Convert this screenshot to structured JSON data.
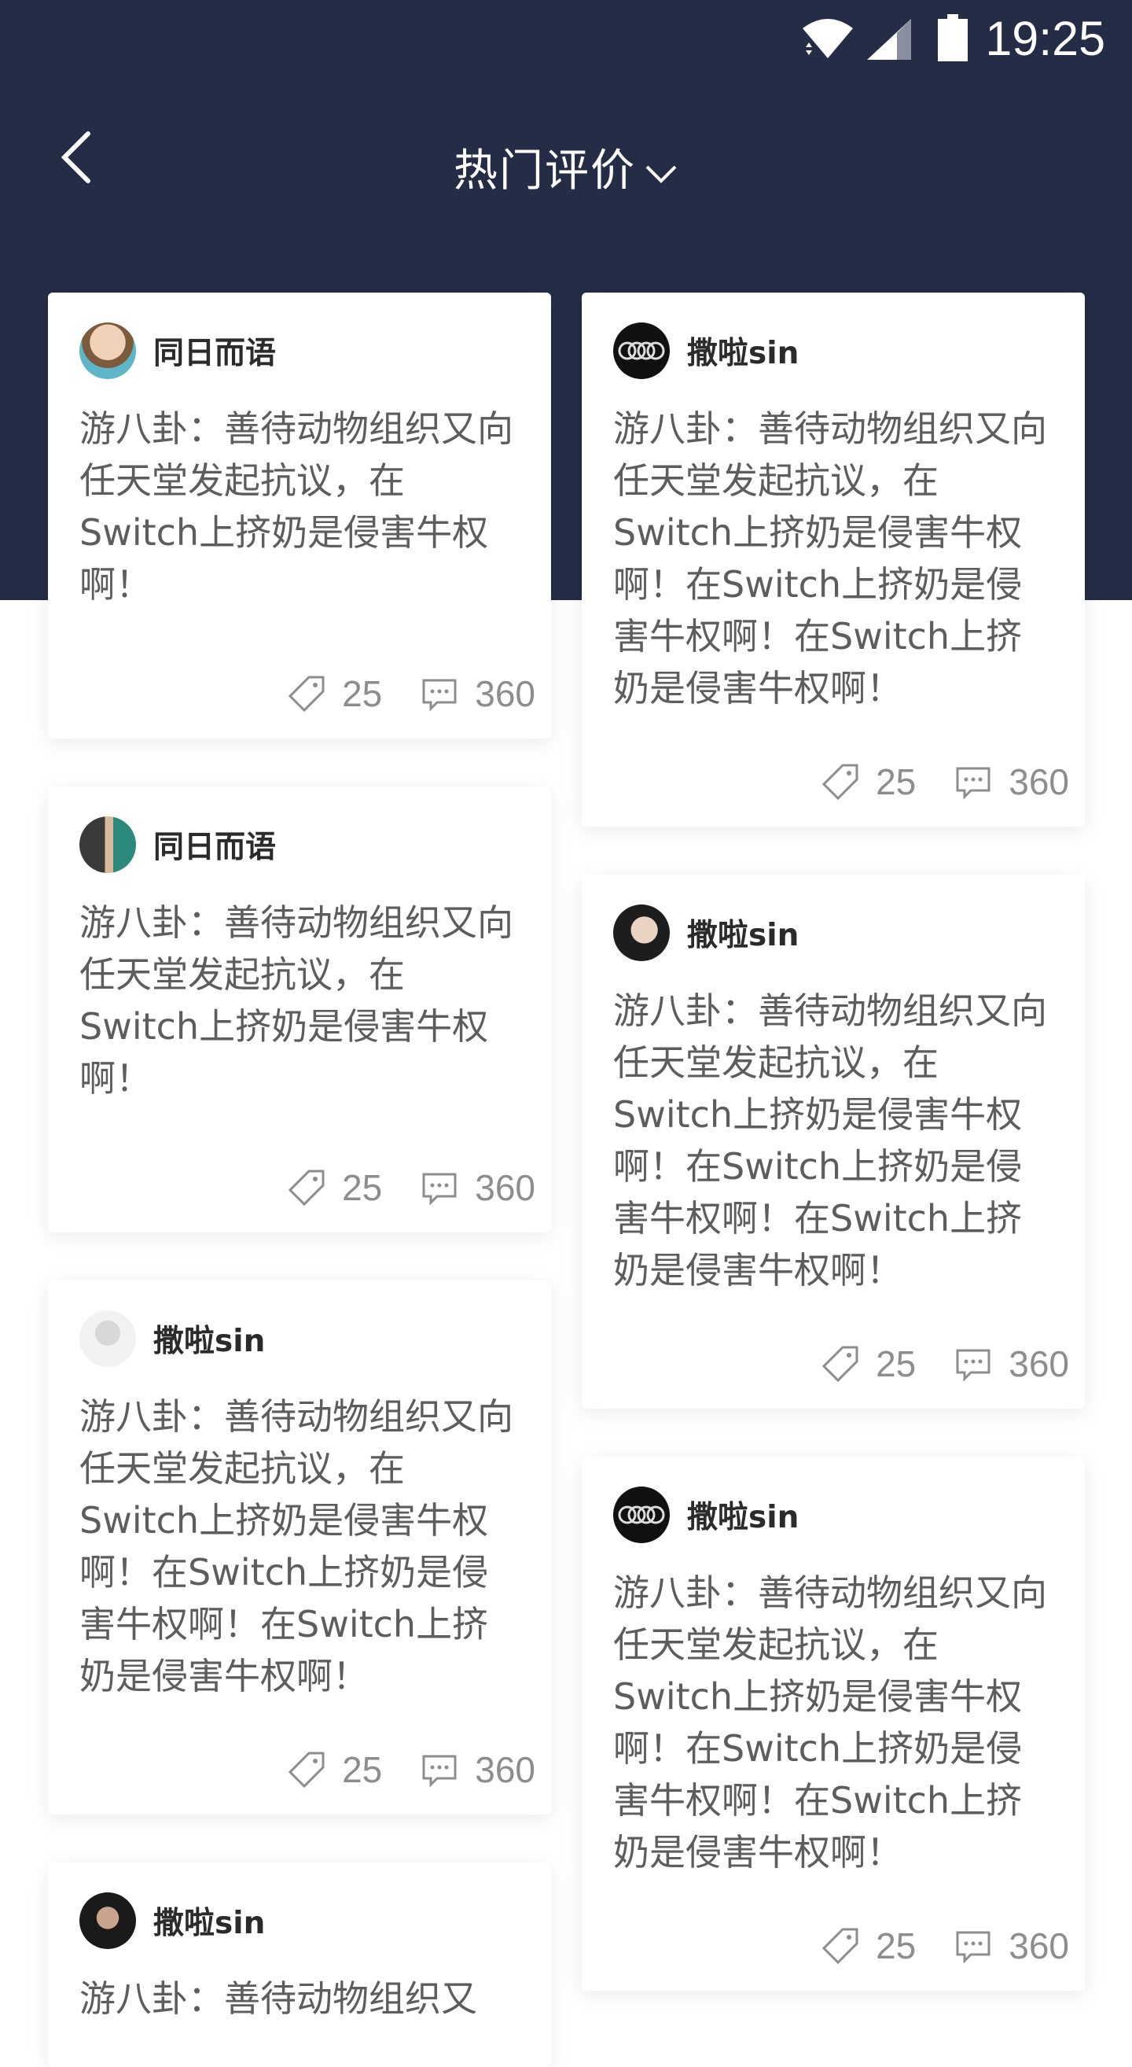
{
  "status_bar": {
    "time": "19:25"
  },
  "nav": {
    "title": "热门评价"
  },
  "cards": [
    {
      "author": "同日而语",
      "avatar": "woman-photo",
      "text": "游八卦：善待动物组织又向任天堂发起抗议，在Switch上挤奶是侵害牛权啊！",
      "likes": "25",
      "comments": "360"
    },
    {
      "author": "撒啦sin",
      "avatar": "rings-logo",
      "text": "游八卦：善待动物组织又向任天堂发起抗议，在Switch上挤奶是侵害牛权啊！在Switch上挤奶是侵害牛权啊！在Switch上挤奶是侵害牛权啊！",
      "likes": "25",
      "comments": "360"
    },
    {
      "author": "同日而语",
      "avatar": "couple-photo",
      "text": "游八卦：善待动物组织又向任天堂发起抗议，在Switch上挤奶是侵害牛权啊！",
      "likes": "25",
      "comments": "360"
    },
    {
      "author": "撒啦sin",
      "avatar": "woman-dark-hair",
      "text": "游八卦：善待动物组织又向任天堂发起抗议，在Switch上挤奶是侵害牛权啊！在Switch上挤奶是侵害牛权啊！在Switch上挤奶是侵害牛权啊！",
      "likes": "25",
      "comments": "360"
    },
    {
      "author": "撒啦sin",
      "avatar": "man-bw",
      "text": "游八卦：善待动物组织又向任天堂发起抗议，在Switch上挤奶是侵害牛权啊！在Switch上挤奶是侵害牛权啊！在Switch上挤奶是侵害牛权啊！",
      "likes": "25",
      "comments": "360"
    },
    {
      "author": "撒啦sin",
      "avatar": "rings-logo",
      "text": "游八卦：善待动物组织又向任天堂发起抗议，在Switch上挤奶是侵害牛权啊！在Switch上挤奶是侵害牛权啊！在Switch上挤奶是侵害牛权啊！",
      "likes": "25",
      "comments": "360"
    },
    {
      "author": "撒啦sin",
      "avatar": "woman-dark",
      "text": "游八卦：善待动物组织又",
      "likes": "",
      "comments": ""
    }
  ],
  "colors": {
    "header": "#252c45",
    "text": "#5d5d5d",
    "meta": "#8d8d8d"
  }
}
